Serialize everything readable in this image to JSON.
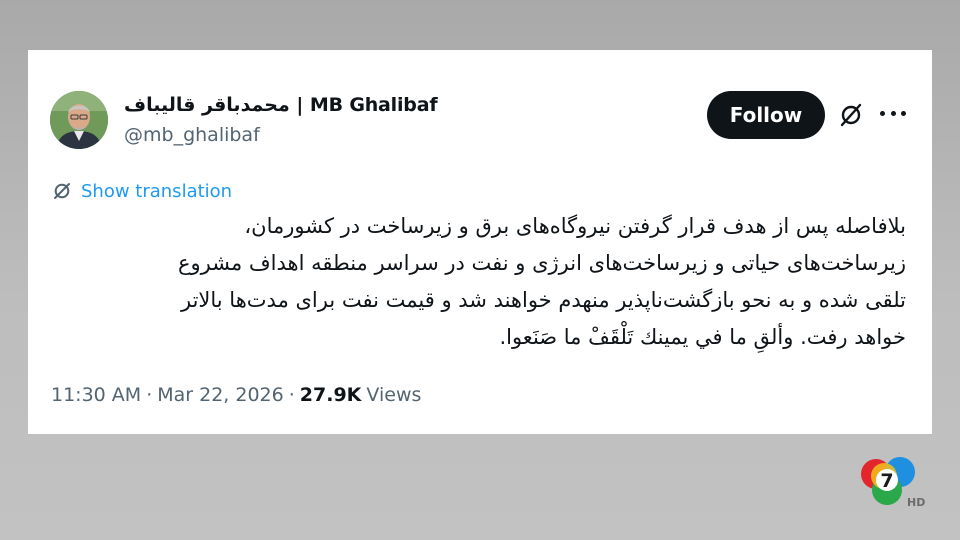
{
  "tweet": {
    "author": {
      "display_name": "محمدباقر قالیباف | MB Ghalibaf",
      "handle": "@mb_ghalibaf"
    },
    "follow_label": "Follow",
    "translation_label": "Show translation",
    "text_lines": [
      "بلافاصله پس از هدف قرار گرفتن نیروگاه‌های برق و زیرساخت در کشورمان،",
      "زیرساخت‌های حیاتی و زیرساخت‌های انرژی و نفت در سراسر منطقه اهداف مشروع",
      "تلقی شده و به نحو بازگشت‌ناپذیر منهدم خواهند شد و قیمت نفت برای مدت‌ها بالاتر",
      "خواهد رفت. وألقِ ما في يمينك تَلْقَفْ ما صَنَعوا."
    ],
    "time": "11:30 AM",
    "date": "Mar 22, 2026",
    "views_count": "27.9K",
    "views_label": "Views",
    "separator": "·"
  },
  "broadcaster": {
    "channel_number": "7",
    "badge": "HD"
  },
  "colors": {
    "accent_blue": "#1d9bf0",
    "text_primary": "#0f1419",
    "text_secondary": "#536471",
    "follow_bg": "#0f1419"
  },
  "icons": [
    "avatar",
    "grok-icon",
    "more-icon",
    "translate-icon",
    "channel-7-logo"
  ]
}
